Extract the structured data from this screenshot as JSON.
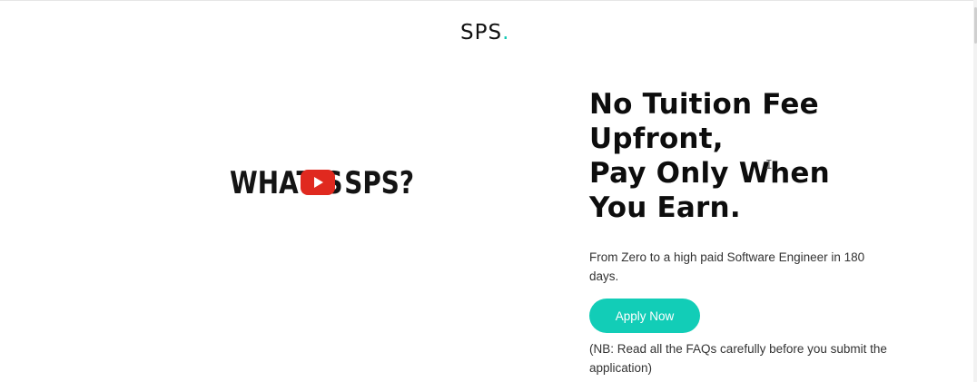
{
  "header": {
    "logo_text": "SPS",
    "logo_dot": ".",
    "accent_color": "#12c9b4"
  },
  "video": {
    "title_left": "WHAT",
    "title_mid": "IS",
    "title_right": "SPS?",
    "play_icon": "youtube-play-icon",
    "play_color": "#e0291f"
  },
  "hero": {
    "headline_lines": [
      "No Tuition Fee",
      "Upfront,",
      "Pay Only When",
      "You Earn."
    ],
    "subtext": "From Zero to a high paid Software Engineer in 180 days.",
    "apply_label": "Apply Now",
    "apply_color": "#12cdb7",
    "note": "(NB: Read all the FAQs carefully before you submit the application)"
  }
}
